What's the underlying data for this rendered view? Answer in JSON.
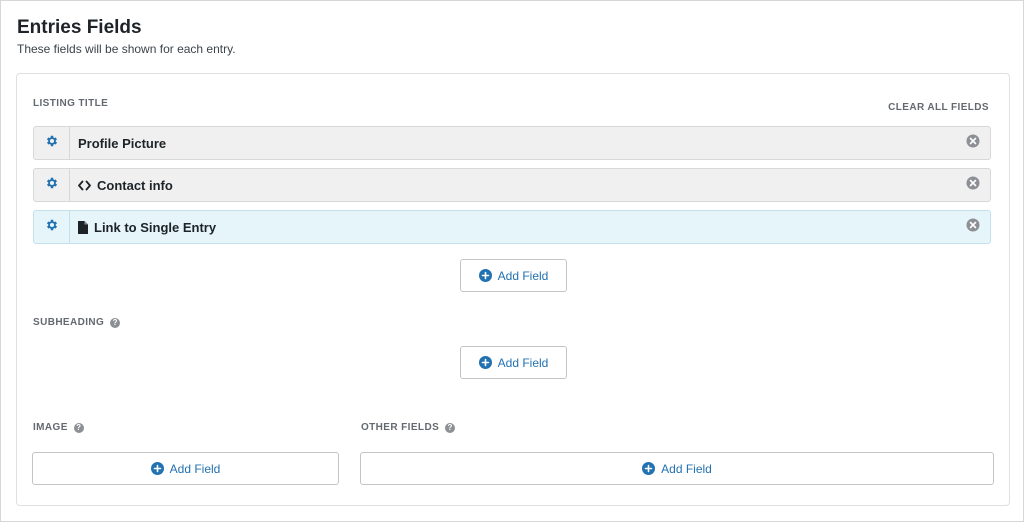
{
  "header": {
    "title": "Entries Fields",
    "subtitle": "These fields will be shown for each entry."
  },
  "clear_all_label": "CLEAR ALL FIELDS",
  "sections": {
    "listing_title": {
      "label": "LISTING TITLE",
      "fields": [
        {
          "label": "Profile Picture",
          "icon": "none",
          "highlighted": false
        },
        {
          "label": "Contact info",
          "icon": "code-icon",
          "highlighted": false
        },
        {
          "label": "Link to Single Entry",
          "icon": "file-icon",
          "highlighted": true
        }
      ],
      "add_label": "Add Field"
    },
    "subheading": {
      "label": "SUBHEADING",
      "help": "?",
      "add_label": "Add Field"
    },
    "image": {
      "label": "IMAGE",
      "help": "?",
      "add_label": "Add Field"
    },
    "other_fields": {
      "label": "OTHER FIELDS",
      "help": "?",
      "add_label": "Add Field"
    }
  },
  "colors": {
    "accent": "#2271b1",
    "highlight_row": "#e5f5fa",
    "row_bg": "#f0f0f1",
    "muted_text": "#646970"
  }
}
